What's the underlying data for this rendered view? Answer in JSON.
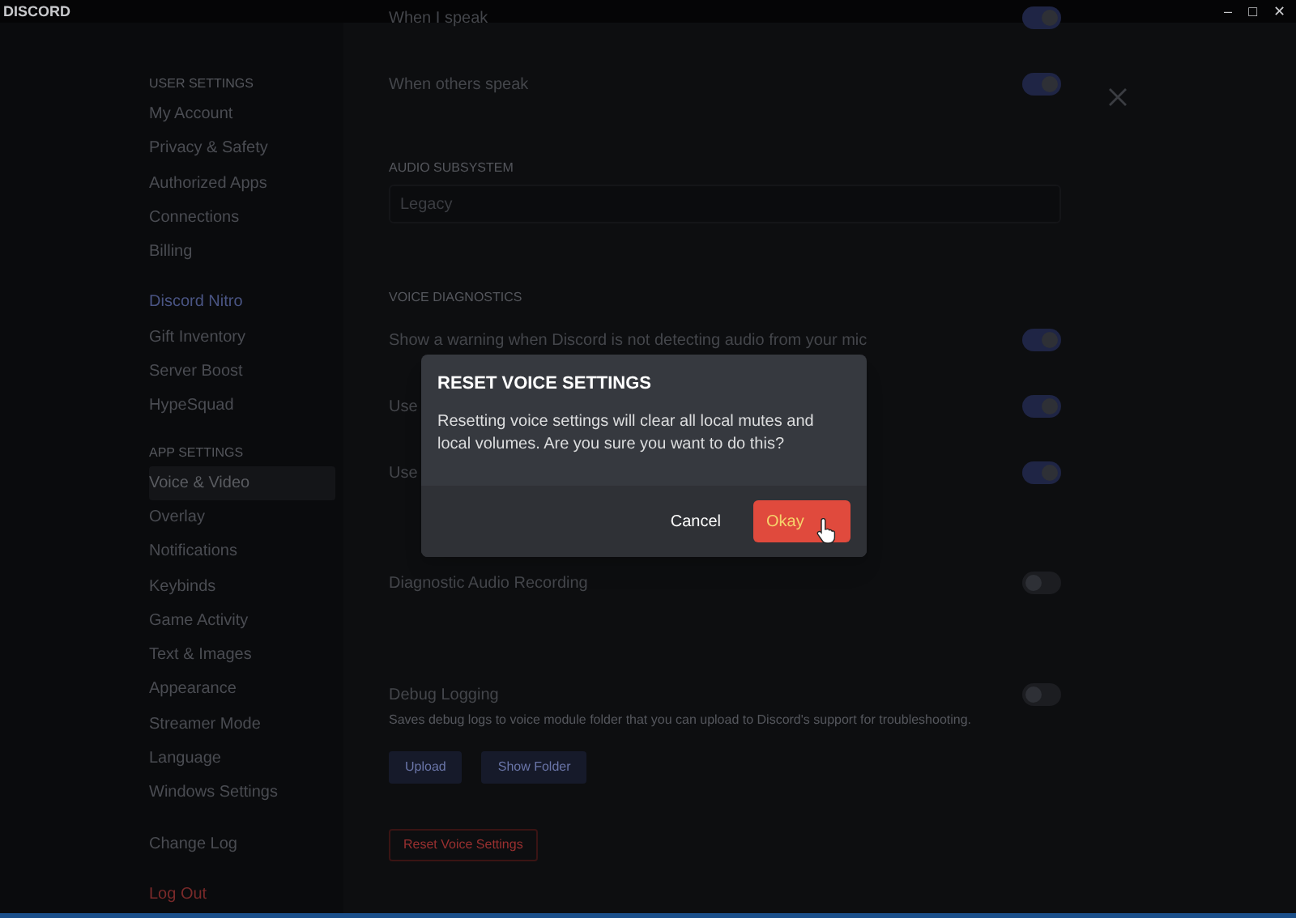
{
  "window": {
    "title": "DISCORD",
    "controls": [
      "–",
      "□",
      "✕"
    ]
  },
  "sidebar": {
    "sections": [
      {
        "heading": "USER SETTINGS",
        "items": [
          {
            "label": "My Account",
            "selected": false,
            "kind": "normal"
          },
          {
            "label": "Privacy & Safety",
            "selected": false,
            "kind": "normal"
          },
          {
            "label": "Authorized Apps",
            "selected": false,
            "kind": "normal"
          },
          {
            "label": "Connections",
            "selected": false,
            "kind": "normal"
          },
          {
            "label": "Billing",
            "selected": false,
            "kind": "normal"
          }
        ]
      },
      {
        "items": [
          {
            "label": "Discord Nitro",
            "selected": false,
            "kind": "nitro"
          },
          {
            "label": "Gift Inventory",
            "selected": false,
            "kind": "normal"
          },
          {
            "label": "Server Boost",
            "selected": false,
            "kind": "normal"
          },
          {
            "label": "HypeSquad",
            "selected": false,
            "kind": "normal"
          }
        ]
      },
      {
        "heading": "APP SETTINGS",
        "items": [
          {
            "label": "Voice & Video",
            "selected": true,
            "kind": "normal"
          },
          {
            "label": "Overlay",
            "selected": false,
            "kind": "normal"
          },
          {
            "label": "Notifications",
            "selected": false,
            "kind": "normal"
          },
          {
            "label": "Keybinds",
            "selected": false,
            "kind": "normal"
          },
          {
            "label": "Game Activity",
            "selected": false,
            "kind": "normal"
          },
          {
            "label": "Text & Images",
            "selected": false,
            "kind": "normal"
          },
          {
            "label": "Appearance",
            "selected": false,
            "kind": "normal"
          },
          {
            "label": "Streamer Mode",
            "selected": false,
            "kind": "normal"
          },
          {
            "label": "Language",
            "selected": false,
            "kind": "normal"
          },
          {
            "label": "Windows Settings",
            "selected": false,
            "kind": "normal"
          }
        ]
      },
      {
        "items": [
          {
            "label": "Change Log",
            "selected": false,
            "kind": "normal"
          }
        ]
      },
      {
        "items": [
          {
            "label": "Log Out",
            "selected": false,
            "kind": "danger"
          }
        ]
      }
    ]
  },
  "content": {
    "rows": [
      {
        "kind": "toggle",
        "label": "When I speak",
        "on": true
      },
      {
        "kind": "toggle",
        "label": "When others speak",
        "on": true
      },
      {
        "kind": "heading",
        "label": "AUDIO SUBSYSTEM"
      },
      {
        "kind": "select",
        "value": "Legacy"
      },
      {
        "kind": "heading",
        "label": "VOICE DIAGNOSTICS"
      },
      {
        "kind": "toggle",
        "label": "Show a warning when Discord is not detecting audio from your mic",
        "on": true
      },
      {
        "kind": "toggle",
        "label": "Use",
        "on": true
      },
      {
        "kind": "toggle",
        "label": "Use",
        "on": true
      },
      {
        "kind": "toggle",
        "label": "Diagnostic Audio Recording",
        "on": false
      },
      {
        "kind": "toggle",
        "label": "Debug Logging",
        "on": false,
        "description": "Saves debug logs to voice module folder that you can upload to Discord's support for troubleshooting."
      },
      {
        "kind": "buttons",
        "buttons": [
          "Upload",
          "Show Folder"
        ]
      },
      {
        "kind": "danger_button",
        "label": "Reset Voice Settings"
      }
    ]
  },
  "dialog": {
    "title": "RESET VOICE SETTINGS",
    "message": "Resetting voice settings will clear all local mutes and local volumes. Are you sure you want to do this?",
    "cancel": "Cancel",
    "confirm": "Okay"
  }
}
